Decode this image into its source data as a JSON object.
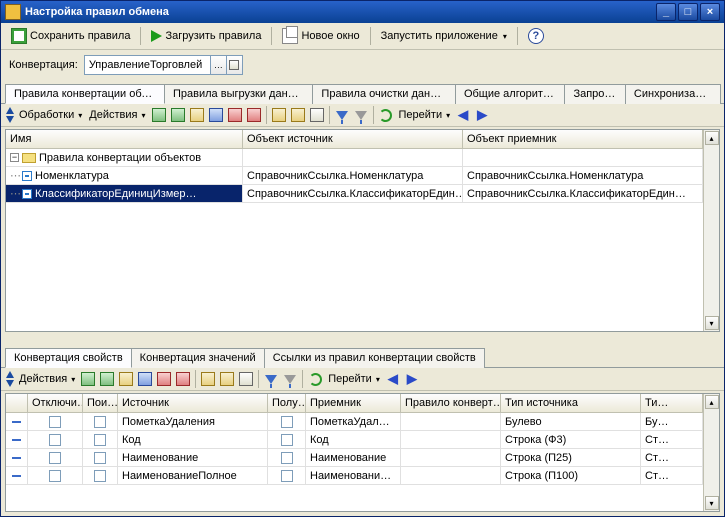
{
  "window": {
    "title": "Настройка правил обмена"
  },
  "toolbar": {
    "save": "Сохранить правила",
    "load": "Загрузить правила",
    "newwin": "Новое окно",
    "run": "Запустить приложение",
    "help": "?"
  },
  "conv": {
    "label": "Конвертация:",
    "value": "УправлениеТорговлей"
  },
  "tabs_top": [
    "Правила конвертации объе…",
    "Правила выгрузки данных",
    "Правила очистки данных",
    "Общие алгоритмы",
    "Запросы",
    "Синхронизация"
  ],
  "sub_top": {
    "obrabotki": "Обработки",
    "deystviya": "Действия",
    "go": "Перейти"
  },
  "grid_top": {
    "cols": [
      "Имя",
      "Объект источник",
      "Объект приемник"
    ],
    "root": "Правила конвертации объектов",
    "rows": [
      {
        "name": "Номенклатура",
        "src": "СправочникСсылка.Номенклатура",
        "dst": "СправочникСсылка.Номенклатура",
        "sel": false
      },
      {
        "name": "КлассификаторЕдиницИзмер…",
        "src": "СправочникСсылка.КлассификаторЕдин…",
        "dst": "СправочникСсылка.КлассификаторЕдин…",
        "sel": true
      }
    ]
  },
  "tabs_bottom": [
    "Конвертация свойств",
    "Конвертация значений",
    "Ссылки из правил конвертации свойств"
  ],
  "sub_bot": {
    "deystviya": "Действия",
    "go": "Перейти"
  },
  "grid_bot": {
    "cols": [
      "",
      "Отключи…",
      "Пои…",
      "Источник",
      "Полу…",
      "Приемник",
      "Правило конверт…",
      "Тип источника",
      "Ти…"
    ],
    "rows": [
      {
        "src": "ПометкаУдаления",
        "dst": "ПометкаУдал…",
        "rule": "",
        "tsrc": "Булево",
        "tdst": "Бу…"
      },
      {
        "src": "Код",
        "dst": "Код",
        "rule": "",
        "tsrc": "Строка (Ф3)",
        "tdst": "Ст…"
      },
      {
        "src": "Наименование",
        "dst": "Наименование",
        "rule": "",
        "tsrc": "Строка (П25)",
        "tdst": "Ст…"
      },
      {
        "src": "НаименованиеПолное",
        "dst": "Наименовани…",
        "rule": "",
        "tsrc": "Строка (П100)",
        "tdst": "Ст…"
      }
    ]
  }
}
